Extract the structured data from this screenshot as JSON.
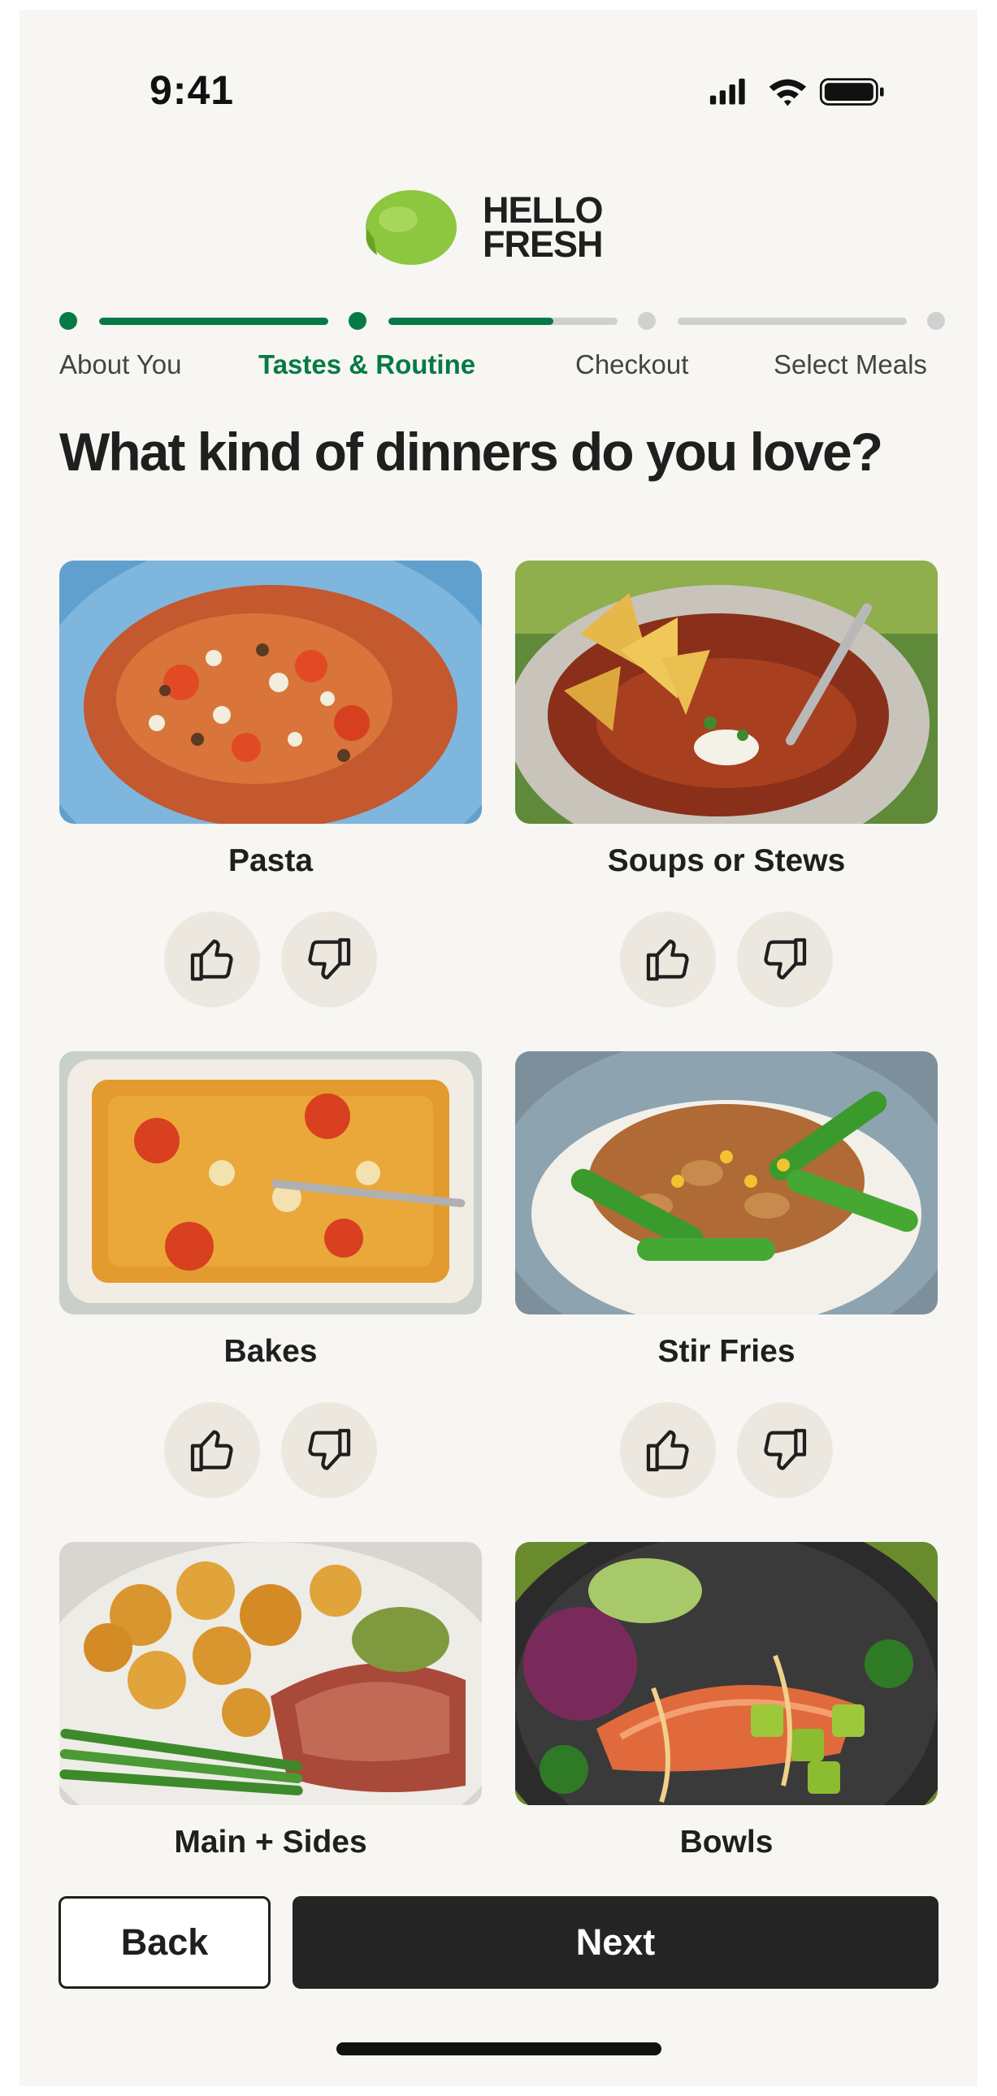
{
  "status_bar": {
    "time": "9:41",
    "icons": [
      "signal-icon",
      "wifi-icon",
      "battery-icon"
    ]
  },
  "brand": {
    "line1": "HELLO",
    "line2": "FRESH",
    "logo_icon": "lime-icon",
    "color": "#8dc63f"
  },
  "progress": {
    "accent": "#067a46",
    "steps": [
      {
        "label": "About You",
        "state": "done"
      },
      {
        "label": "Tastes & Routine",
        "state": "current"
      },
      {
        "label": "Checkout",
        "state": "todo"
      },
      {
        "label": "Select Meals",
        "state": "todo"
      }
    ],
    "current_segment_fill": 0.72
  },
  "question": "What kind of dinners do you love?",
  "categories": [
    {
      "label": "Pasta",
      "image": "pasta-photo"
    },
    {
      "label": "Soups or Stews",
      "image": "soup-photo"
    },
    {
      "label": "Bakes",
      "image": "bake-photo"
    },
    {
      "label": "Stir Fries",
      "image": "stirfry-photo"
    },
    {
      "label": "Main + Sides",
      "image": "main-sides-photo"
    },
    {
      "label": "Bowls",
      "image": "bowl-photo"
    }
  ],
  "vote_icons": {
    "like": "thumbs-up-icon",
    "dislike": "thumbs-down-icon"
  },
  "footer": {
    "back_label": "Back",
    "next_label": "Next"
  }
}
